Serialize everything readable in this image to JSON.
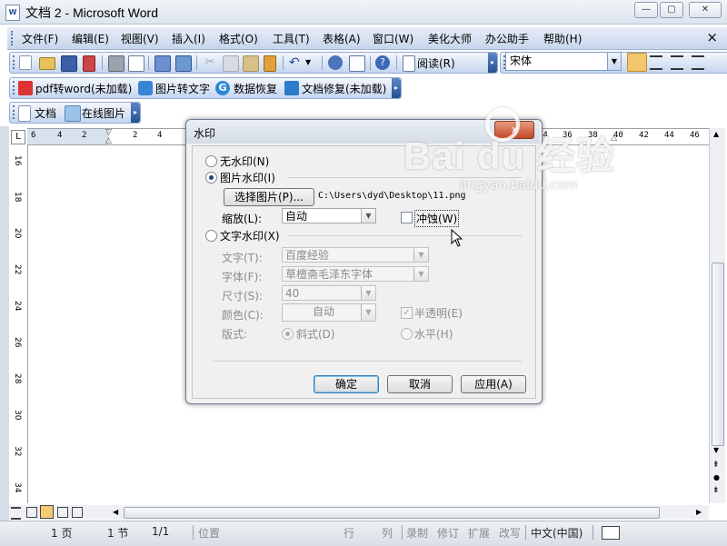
{
  "window": {
    "title": "文档 2 - Microsoft Word",
    "app_icon": "word-doc-icon",
    "app_icon_text": "W"
  },
  "menu": {
    "items": [
      "文件(F)",
      "编辑(E)",
      "视图(V)",
      "插入(I)",
      "格式(O)",
      "工具(T)",
      "表格(A)",
      "窗口(W)",
      "美化大师",
      "办公助手",
      "帮助(H)"
    ],
    "close_symbol": "×"
  },
  "toolbar_standard": {
    "read_label": "阅读(R)",
    "font_name": "宋体"
  },
  "toolbar_plugins": {
    "items": [
      "pdf转word(未加载)",
      "图片转文字",
      "数据恢复",
      "文档修复(未加载)"
    ]
  },
  "toolbar_tabs": {
    "items": [
      "文档",
      "在线图片"
    ]
  },
  "ruler": {
    "h_numbers": [
      "6",
      "4",
      "2",
      "2",
      "4",
      "34",
      "36",
      "38",
      "40",
      "42",
      "44",
      "46"
    ],
    "v_numbers": [
      "16",
      "18",
      "20",
      "22",
      "24",
      "26",
      "28",
      "30",
      "32",
      "34"
    ],
    "corner": "L"
  },
  "status": {
    "page": "1 页",
    "section": "1 节",
    "pages": "1/1",
    "position": "位置",
    "line": "行",
    "col": "列",
    "rec": "录制",
    "trk": "修订",
    "ext": "扩展",
    "ovr": "改写",
    "language": "中文(中国)"
  },
  "dialog": {
    "title": "水印",
    "close_symbol": "x",
    "no_watermark": "无水印(N)",
    "picture_watermark": "图片水印(I)",
    "select_picture_button": "选择图片(P)...",
    "picture_path": "C:\\Users\\dyd\\Desktop\\11.png",
    "scale_label": "缩放(L):",
    "scale_value": "自动",
    "washout_label": "冲蚀(W)",
    "text_watermark": "文字水印(X)",
    "text_label": "文字(T):",
    "text_value": "百度经验",
    "font_label": "字体(F):",
    "font_value": "草檀斋毛泽东字体",
    "size_label": "尺寸(S):",
    "size_value": "40",
    "color_label": "颜色(C):",
    "color_value": "自动",
    "semitransparent_label": "半透明(E)",
    "layout_label": "版式:",
    "diagonal_label": "斜式(D)",
    "horizontal_label": "水平(H)",
    "ok_button": "确定",
    "cancel_button": "取消",
    "apply_button": "应用(A)"
  },
  "watermark_overlay": {
    "brand": "Bai du 经验",
    "url": "jingyan.baidu.com"
  },
  "colors": {
    "accent": "#24508f",
    "close_red": "#c3482a",
    "toolbar_bg": "#c5d6f0"
  }
}
